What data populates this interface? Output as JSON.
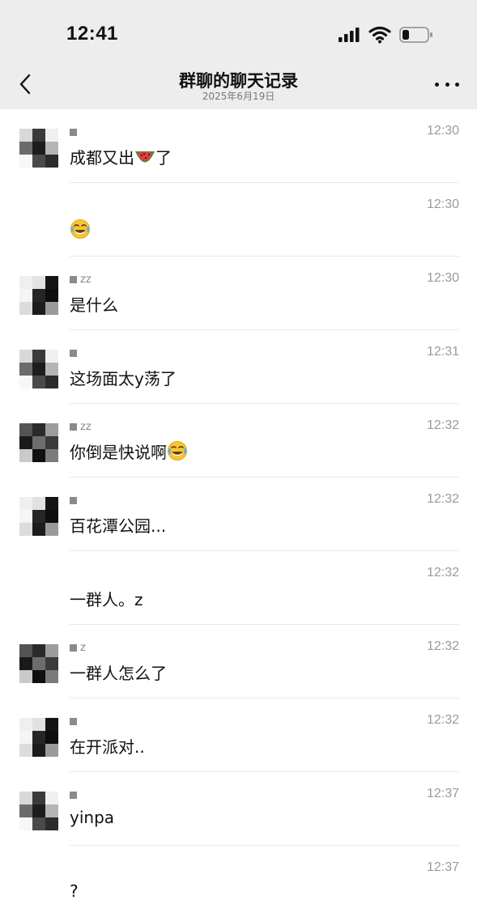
{
  "status_bar": {
    "time": "12:41"
  },
  "header": {
    "title": "群聊的聊天记录",
    "date": "2025年6月19日",
    "back_icon": "chevron-left-icon",
    "more_icon": "more-dots-icon"
  },
  "messages": [
    {
      "name": "",
      "text": "成都又出",
      "emoji": "watermelon",
      "suffix": "了",
      "time": "12:30",
      "avatar": true
    },
    {
      "name": "",
      "text": "",
      "emoji": "laughing-crying",
      "suffix": "",
      "time": "12:30",
      "avatar": false
    },
    {
      "name": "zz",
      "text": "是什么",
      "emoji": "",
      "suffix": "",
      "time": "12:30",
      "avatar": true
    },
    {
      "name": "",
      "text": "这场面太y荡了",
      "emoji": "",
      "suffix": "",
      "time": "12:31",
      "avatar": true
    },
    {
      "name": "zz",
      "text": "你倒是快说啊",
      "emoji": "tears-of-joy",
      "suffix": "",
      "time": "12:32",
      "avatar": true
    },
    {
      "name": "",
      "text": "百花潭公园...",
      "emoji": "",
      "suffix": "",
      "time": "12:32",
      "avatar": true
    },
    {
      "name": "",
      "text": "一群人。z",
      "emoji": "",
      "suffix": "",
      "time": "12:32",
      "avatar": false
    },
    {
      "name": "z",
      "text": "一群人怎么了",
      "emoji": "",
      "suffix": "",
      "time": "12:32",
      "avatar": true
    },
    {
      "name": "",
      "text": "在开派对..",
      "emoji": "",
      "suffix": "",
      "time": "12:32",
      "avatar": true
    },
    {
      "name": "",
      "text": "yinpa",
      "emoji": "",
      "suffix": "",
      "time": "12:37",
      "avatar": true
    },
    {
      "name": "",
      "text": "?",
      "emoji": "",
      "suffix": "",
      "time": "12:37",
      "avatar": false
    }
  ],
  "colors": {
    "header_bg": "#ededed",
    "background": "#ffffff",
    "time_text": "#9a9a9a",
    "divider": "#e9e9e9"
  }
}
